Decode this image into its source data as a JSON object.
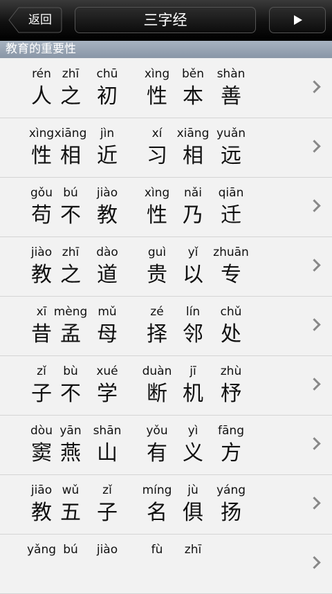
{
  "header": {
    "back_label": "返回",
    "title": "三字经"
  },
  "section": {
    "title": "教育的重要性"
  },
  "rows": [
    {
      "pinyin": [
        "rén",
        "zhī",
        "chū",
        "xìng",
        "běn",
        "shàn"
      ],
      "chars": [
        "人",
        "之",
        "初",
        "性",
        "本",
        "善"
      ]
    },
    {
      "pinyin": [
        "xìng",
        "xiāng",
        "jìn",
        "xí",
        "xiāng",
        "yuǎn"
      ],
      "chars": [
        "性",
        "相",
        "近",
        "习",
        "相",
        "远"
      ]
    },
    {
      "pinyin": [
        "gǒu",
        "bú",
        "jiào",
        "xìng",
        "nǎi",
        "qiān"
      ],
      "chars": [
        "苟",
        "不",
        "教",
        "性",
        "乃",
        "迁"
      ]
    },
    {
      "pinyin": [
        "jiào",
        "zhī",
        "dào",
        "guì",
        "yǐ",
        "zhuān"
      ],
      "chars": [
        "教",
        "之",
        "道",
        "贵",
        "以",
        "专"
      ]
    },
    {
      "pinyin": [
        "xī",
        "mèng",
        "mǔ",
        "zé",
        "lín",
        "chǔ"
      ],
      "chars": [
        "昔",
        "孟",
        "母",
        "择",
        "邻",
        "处"
      ]
    },
    {
      "pinyin": [
        "zǐ",
        "bù",
        "xué",
        "duàn",
        "jī",
        "zhù"
      ],
      "chars": [
        "子",
        "不",
        "学",
        "断",
        "机",
        "杼"
      ]
    },
    {
      "pinyin": [
        "dòu",
        "yān",
        "shān",
        "yǒu",
        "yì",
        "fāng"
      ],
      "chars": [
        "窦",
        "燕",
        "山",
        "有",
        "义",
        "方"
      ]
    },
    {
      "pinyin": [
        "jiāo",
        "wǔ",
        "zǐ",
        "míng",
        "jù",
        "yáng"
      ],
      "chars": [
        "教",
        "五",
        "子",
        "名",
        "俱",
        "扬"
      ]
    },
    {
      "pinyin": [
        "yǎng",
        "bú",
        "jiào",
        "fù",
        "zhī",
        ""
      ],
      "chars": [
        "",
        "",
        "",
        "",
        "",
        ""
      ]
    }
  ]
}
